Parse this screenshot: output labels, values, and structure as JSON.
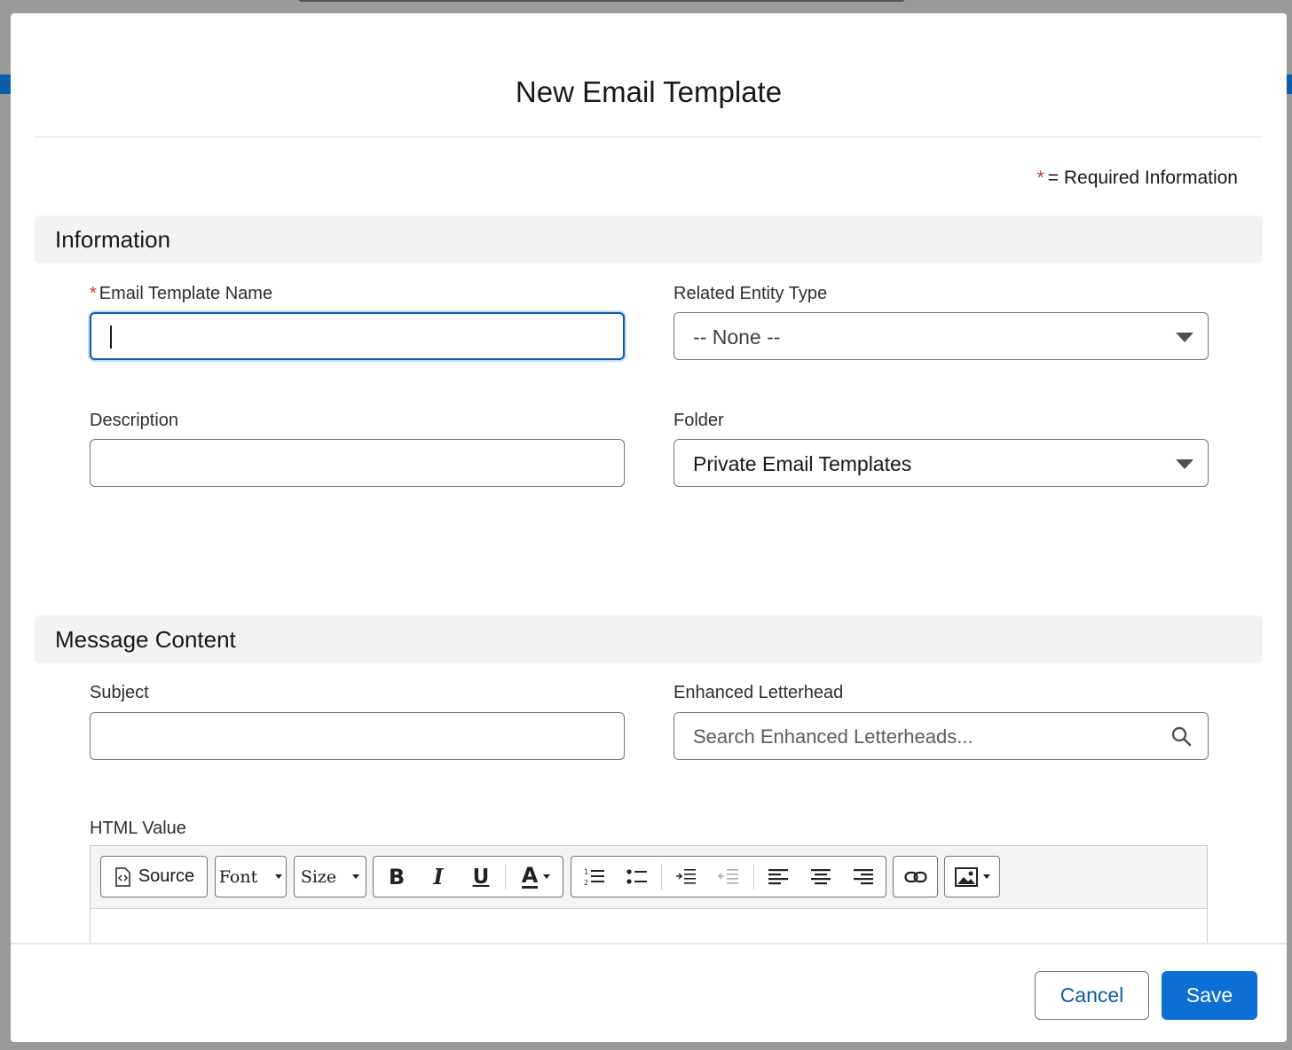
{
  "modal": {
    "title": "New Email Template",
    "required_note": "= Required Information",
    "required_star": "*"
  },
  "sections": {
    "information": "Information",
    "message_content": "Message Content"
  },
  "fields": {
    "template_name": {
      "label": "Email Template Name",
      "required_star": "*",
      "value": ""
    },
    "related_entity_type": {
      "label": "Related Entity Type",
      "value": "-- None --"
    },
    "description": {
      "label": "Description",
      "value": ""
    },
    "folder": {
      "label": "Folder",
      "value": "Private Email Templates"
    },
    "subject": {
      "label": "Subject",
      "value": ""
    },
    "enhanced_letterhead": {
      "label": "Enhanced Letterhead",
      "placeholder": "Search Enhanced Letterheads..."
    },
    "html_value": {
      "label": "HTML Value"
    }
  },
  "editor_toolbar": {
    "source_label": "Source",
    "font_label": "Font",
    "size_label": "Size",
    "bold_label": "B",
    "italic_label": "I",
    "underline_label": "U",
    "text_color_label": "A"
  },
  "footer": {
    "cancel_label": "Cancel",
    "save_label": "Save"
  },
  "colors": {
    "brand_blue": "#0b6fd4",
    "focus_blue": "#0b5cab",
    "required_red": "#c23934"
  }
}
